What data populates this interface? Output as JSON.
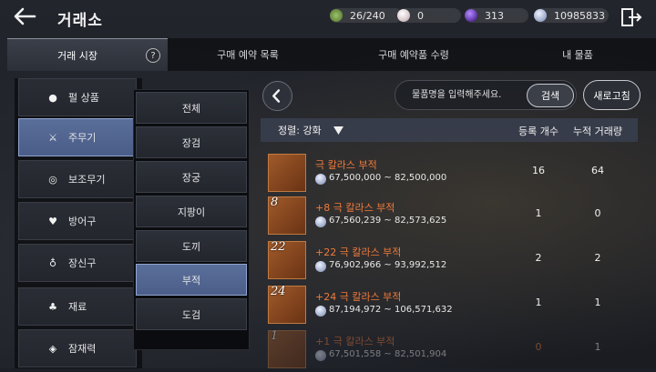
{
  "header": {
    "title": "거래소",
    "resources": {
      "weight": "26/240",
      "pearl": "0",
      "gem": "313",
      "silver": "10985833"
    }
  },
  "tabs": [
    {
      "label": "거래 시장"
    },
    {
      "label": "구매 예약 목록"
    },
    {
      "label": "구매 예약품 수령"
    },
    {
      "label": "내 물품"
    }
  ],
  "categories": [
    {
      "label": "펄 상품",
      "icon": "pearl-icon"
    },
    {
      "label": "주무기",
      "icon": "crossed-swords-icon"
    },
    {
      "label": "보조무기",
      "icon": "ring-target-icon"
    },
    {
      "label": "방어구",
      "icon": "armor-icon"
    },
    {
      "label": "장신구",
      "icon": "necklace-icon"
    },
    {
      "label": "재료",
      "icon": "potion-icon"
    },
    {
      "label": "잠재력",
      "icon": "diamond-icon"
    }
  ],
  "subcategories": [
    {
      "label": "전체"
    },
    {
      "label": "장검"
    },
    {
      "label": "장궁"
    },
    {
      "label": "지팡이"
    },
    {
      "label": "도끼"
    },
    {
      "label": "부적"
    },
    {
      "label": "도검"
    }
  ],
  "search": {
    "placeholder": "물품명을 입력해주세요.",
    "button": "검색",
    "refresh": "새로고침"
  },
  "table": {
    "sort_label": "정렬: 강화",
    "col_count": "등록 개수",
    "col_volume": "누적 거래량",
    "rows": [
      {
        "enh": "",
        "name": "극 칼라스 부적",
        "price": "67,500,000 ~ 82,500,000",
        "count": "16",
        "volume": "64"
      },
      {
        "enh": "8",
        "name": "+8 극 칼라스 부적",
        "price": "67,560,239 ~ 82,573,625",
        "count": "1",
        "volume": "0"
      },
      {
        "enh": "22",
        "name": "+22 극 칼라스 부적",
        "price": "76,902,966 ~ 93,992,512",
        "count": "2",
        "volume": "2"
      },
      {
        "enh": "24",
        "name": "+24 극 칼라스 부적",
        "price": "87,194,972 ~ 106,571,632",
        "count": "1",
        "volume": "1"
      },
      {
        "enh": "1",
        "name": "+1 극 칼라스 부적",
        "price": "67,501,558 ~ 82,501,904",
        "count": "0",
        "volume": "1"
      }
    ]
  },
  "colors": {
    "accent_blue": "#5a6e9a",
    "item_name_orange": "#f07a3a"
  }
}
